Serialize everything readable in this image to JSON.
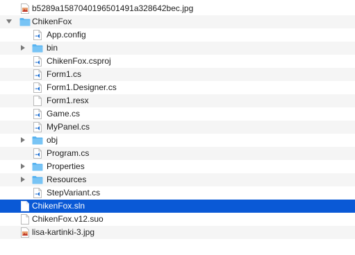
{
  "colors": {
    "selection": "#0a59d6",
    "folder": "#58b3f0",
    "vs_icon": "#1f6fd1",
    "alt_row": "#f5f5f5"
  },
  "rows": [
    {
      "label": "b5289a1587040196501491a328642bec.jpg",
      "icon": "image-icon",
      "disclosure": "none",
      "level": 0
    },
    {
      "label": "ChikenFox",
      "icon": "folder-icon",
      "disclosure": "expanded",
      "level": 0
    },
    {
      "label": "App.config",
      "icon": "vs-file-icon",
      "disclosure": "none",
      "level": 1
    },
    {
      "label": "bin",
      "icon": "folder-icon",
      "disclosure": "collapsed",
      "level": 1
    },
    {
      "label": "ChikenFox.csproj",
      "icon": "vs-file-icon",
      "disclosure": "none",
      "level": 1
    },
    {
      "label": "Form1.cs",
      "icon": "vs-file-icon",
      "disclosure": "none",
      "level": 1
    },
    {
      "label": "Form1.Designer.cs",
      "icon": "vs-file-icon",
      "disclosure": "none",
      "level": 1
    },
    {
      "label": "Form1.resx",
      "icon": "document-icon",
      "disclosure": "none",
      "level": 1
    },
    {
      "label": "Game.cs",
      "icon": "vs-file-icon",
      "disclosure": "none",
      "level": 1
    },
    {
      "label": "MyPanel.cs",
      "icon": "vs-file-icon",
      "disclosure": "none",
      "level": 1
    },
    {
      "label": "obj",
      "icon": "folder-icon",
      "disclosure": "collapsed",
      "level": 1
    },
    {
      "label": "Program.cs",
      "icon": "vs-file-icon",
      "disclosure": "none",
      "level": 1
    },
    {
      "label": "Properties",
      "icon": "folder-icon",
      "disclosure": "collapsed",
      "level": 1
    },
    {
      "label": "Resources",
      "icon": "folder-icon",
      "disclosure": "collapsed",
      "level": 1
    },
    {
      "label": "StepVariant.cs",
      "icon": "vs-file-icon",
      "disclosure": "none",
      "level": 1
    },
    {
      "label": "ChikenFox.sln",
      "icon": "document-icon",
      "disclosure": "none",
      "level": 0,
      "selected": true
    },
    {
      "label": "ChikenFox.v12.suo",
      "icon": "document-icon",
      "disclosure": "none",
      "level": 0
    },
    {
      "label": "lisa-kartinki-3.jpg",
      "icon": "image-icon",
      "disclosure": "none",
      "level": 0
    }
  ]
}
